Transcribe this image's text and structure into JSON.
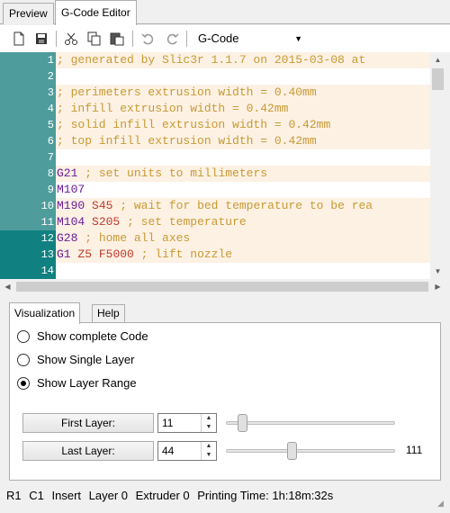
{
  "tabs": [
    {
      "label": "Preview",
      "active": false
    },
    {
      "label": "G-Code Editor",
      "active": true
    }
  ],
  "toolbar": {
    "icons": [
      "new-file-icon",
      "save-icon",
      "cut-icon",
      "copy-icon",
      "paste-icon",
      "undo-icon",
      "redo-icon"
    ],
    "language_select": "G-Code"
  },
  "editor": {
    "lines": [
      {
        "n": "1",
        "text": "; generated by Slic3r 1.1.7 on 2015-03-08 at",
        "kind": "comment"
      },
      {
        "n": "2",
        "text": "",
        "kind": "comment"
      },
      {
        "n": "3",
        "text": "; perimeters extrusion width = 0.40mm",
        "kind": "comment"
      },
      {
        "n": "4",
        "text": "; infill extrusion width = 0.42mm",
        "kind": "comment"
      },
      {
        "n": "5",
        "text": "; solid infill extrusion width = 0.42mm",
        "kind": "comment"
      },
      {
        "n": "6",
        "text": "; top infill extrusion width = 0.42mm",
        "kind": "comment"
      },
      {
        "n": "7",
        "text": "",
        "kind": "comment"
      },
      {
        "n": "8",
        "text": "G21 ; set units to millimeters",
        "kind": "gcode"
      },
      {
        "n": "9",
        "text": "M107",
        "kind": "gcode"
      },
      {
        "n": "10",
        "text": "M190 S45 ; wait for bed temperature to be rea",
        "kind": "gcode"
      },
      {
        "n": "11",
        "text": "M104 S205 ; set temperature",
        "kind": "gcode"
      },
      {
        "n": "12",
        "text": "G28 ; home all axes",
        "kind": "gcode"
      },
      {
        "n": "13",
        "text": "G1 Z5 F5000 ; lift nozzle",
        "kind": "gcode"
      },
      {
        "n": "14",
        "text": "",
        "kind": "gcode"
      }
    ],
    "colors": {
      "gutter_normal": "#4f9c9c",
      "gutter_selected": "#118080",
      "comment": "#c79a32",
      "command": "#6a1b9a",
      "param": "#c0392b"
    }
  },
  "panel": {
    "tabs": [
      {
        "label": "Visualization",
        "active": true
      },
      {
        "label": "Help",
        "active": false
      }
    ],
    "radios": [
      {
        "label": "Show complete Code",
        "checked": false
      },
      {
        "label": "Show Single Layer",
        "checked": false
      },
      {
        "label": "Show Layer Range",
        "checked": true
      }
    ],
    "first_layer": {
      "label": "First Layer:",
      "value": "11",
      "fraction": 0.1
    },
    "last_layer": {
      "label": "Last Layer:",
      "value": "44",
      "fraction": 0.39
    },
    "slider_max": "111"
  },
  "status": {
    "row": "R1",
    "col": "C1",
    "mode": "Insert",
    "layer": "Layer 0",
    "extruder": "Extruder 0",
    "printing_time": "Printing Time: 1h:18m:32s"
  }
}
